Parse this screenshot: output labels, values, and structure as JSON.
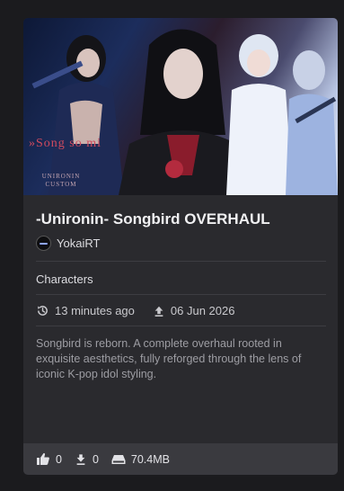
{
  "card": {
    "thumbnail": {
      "caption": "»Song so mi",
      "sub_caption": "UNIRONIN CUSTOM"
    },
    "title": "-Unironin- Songbird OVERHAUL",
    "author": {
      "name": "YokaiRT",
      "avatar_icon": "avatar-icon"
    },
    "category": "Characters",
    "updated": "13 minutes ago",
    "uploaded": "06 Jun 2026",
    "description": "Songbird is reborn. A complete overhaul rooted in exquisite aesthetics, fully reforged through the lens of iconic K-pop idol styling.",
    "stats": {
      "endorsements": "0",
      "downloads": "0",
      "size": "70.4MB"
    }
  }
}
